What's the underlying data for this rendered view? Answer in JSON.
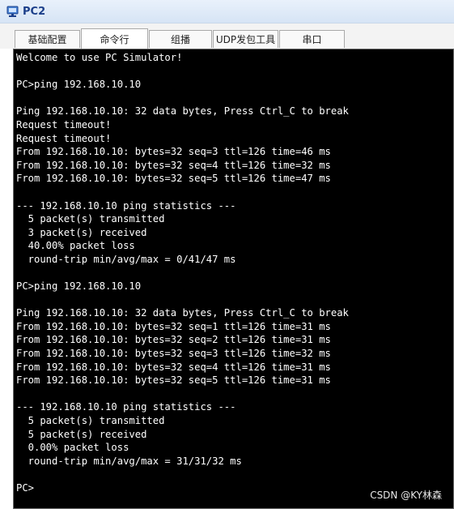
{
  "window": {
    "title": "PC2",
    "icon": "pc-icon"
  },
  "tabs": [
    {
      "label": "基础配置",
      "active": false
    },
    {
      "label": "命令行",
      "active": true
    },
    {
      "label": "组播",
      "active": false
    },
    {
      "label": "UDP发包工具",
      "active": false
    },
    {
      "label": "串口",
      "active": false
    }
  ],
  "terminal": {
    "lines": [
      "Welcome to use PC Simulator!",
      "",
      "PC>ping 192.168.10.10",
      "",
      "Ping 192.168.10.10: 32 data bytes, Press Ctrl_C to break",
      "Request timeout!",
      "Request timeout!",
      "From 192.168.10.10: bytes=32 seq=3 ttl=126 time=46 ms",
      "From 192.168.10.10: bytes=32 seq=4 ttl=126 time=32 ms",
      "From 192.168.10.10: bytes=32 seq=5 ttl=126 time=47 ms",
      "",
      "--- 192.168.10.10 ping statistics ---",
      "  5 packet(s) transmitted",
      "  3 packet(s) received",
      "  40.00% packet loss",
      "  round-trip min/avg/max = 0/41/47 ms",
      "",
      "PC>ping 192.168.10.10",
      "",
      "Ping 192.168.10.10: 32 data bytes, Press Ctrl_C to break",
      "From 192.168.10.10: bytes=32 seq=1 ttl=126 time=31 ms",
      "From 192.168.10.10: bytes=32 seq=2 ttl=126 time=31 ms",
      "From 192.168.10.10: bytes=32 seq=3 ttl=126 time=32 ms",
      "From 192.168.10.10: bytes=32 seq=4 ttl=126 time=31 ms",
      "From 192.168.10.10: bytes=32 seq=5 ttl=126 time=31 ms",
      "",
      "--- 192.168.10.10 ping statistics ---",
      "  5 packet(s) transmitted",
      "  5 packet(s) received",
      "  0.00% packet loss",
      "  round-trip min/avg/max = 31/31/32 ms",
      "",
      "PC>"
    ]
  },
  "watermark": "CSDN @KY林森"
}
